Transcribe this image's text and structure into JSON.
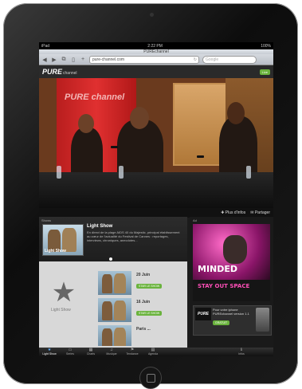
{
  "status": {
    "carrier": "iPad",
    "time": "2:22 PM",
    "battery": "100%"
  },
  "browser": {
    "title": "PUREchannel",
    "url": "pure-channel.com",
    "search_placeholder": "Google",
    "back_icon": "back-arrow-icon",
    "forward_icon": "forward-arrow-icon"
  },
  "site": {
    "logo": "PURE",
    "logo_sub": "channel",
    "live_label": "Live"
  },
  "video": {
    "watermark": "PURE channel",
    "more_info": "Plus d'infos",
    "share": "Partager"
  },
  "shows": {
    "section_label": "Shows",
    "featured_title": "Light Show",
    "featured_desc": "En direct de la plage AIDS 40 du Majestic, principal établissement au cœur de l'actualité du Festival de Cannes : reportages, interviews, chroniques, anecdotes...",
    "thumb_caption": "Light Show",
    "category_label": "Light Show",
    "episodes": [
      {
        "date": "20 Juin",
        "button": "STAR LE SHOW"
      },
      {
        "date": "16 Juin",
        "button": "STAR LE SHOW"
      },
      {
        "date": "Paris ..."
      }
    ]
  },
  "ad": {
    "label": "Ad",
    "line1": "MINDED",
    "line2": "STAY OUT SPACE"
  },
  "promo": {
    "text": "Pour votre iphone PUREchannel version 1.1",
    "button": "GRATUIT"
  },
  "tabs": [
    {
      "label": "Light Show",
      "icon": "star-icon"
    },
    {
      "label": "Series",
      "icon": "tv-icon"
    },
    {
      "label": "Charts",
      "icon": "chart-icon"
    },
    {
      "label": "Musique",
      "icon": "music-icon"
    },
    {
      "label": "Tendance",
      "icon": "trend-icon"
    },
    {
      "label": "Agenda",
      "icon": "calendar-icon"
    },
    {
      "label": "Infos",
      "icon": "info-icon"
    }
  ],
  "colors": {
    "accent_green": "#6ab33d",
    "active_tab": "#5fb0ff",
    "curtain_red": "#d02828"
  }
}
